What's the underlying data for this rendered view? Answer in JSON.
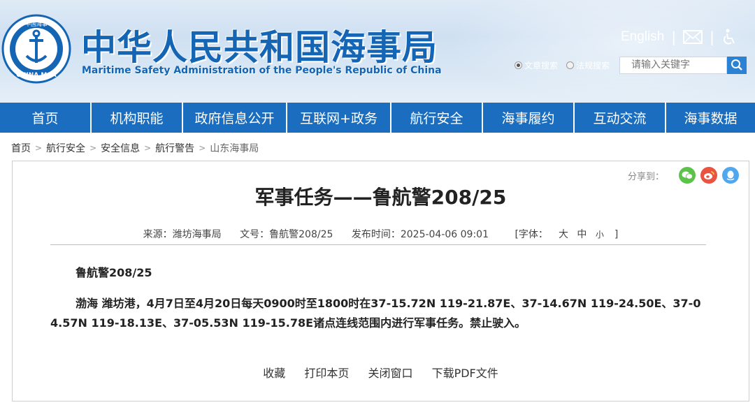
{
  "header": {
    "title": "中华人民共和国海事局",
    "subtitle": "Maritime Safety Administration of the People's Republic of China",
    "logo_text": "CHINA MSA",
    "logo_top_text": "中国海事",
    "english_label": "English",
    "icons": [
      "mail-icon",
      "accessibility-icon"
    ],
    "search": {
      "options": [
        {
          "label": "文章搜索",
          "selected": true
        },
        {
          "label": "法规搜索",
          "selected": false
        }
      ],
      "placeholder": "请输入关键字"
    },
    "brand_color": "#1565b5"
  },
  "nav": {
    "items": [
      "首页",
      "机构职能",
      "政府信息公开",
      "互联网+政务",
      "航行安全",
      "海事履约",
      "互动交流",
      "海事数据"
    ],
    "color": "#1a6dbf"
  },
  "breadcrumb": [
    "首页",
    "航行安全",
    "安全信息",
    "航行警告",
    "山东海事局"
  ],
  "share": {
    "label": "分享到：",
    "icons": [
      "wechat-icon",
      "weibo-icon",
      "qq-icon"
    ],
    "colors": [
      "#5cc24a",
      "#e9533f",
      "#4ea7ef"
    ]
  },
  "article": {
    "title": "军事任务——鲁航警208/25",
    "meta": {
      "source": "来源：潍坊海事局",
      "doc_no": "文号：鲁航警208/25",
      "published": "发布时间：2025-04-06 09:01",
      "font_label": "[字体：",
      "font_large": "大",
      "font_medium": "中",
      "font_small": "小",
      "font_close": "]"
    },
    "paragraphs": [
      "鲁航警208/25",
      "渤海 潍坊港，4月7日至4月20日每天0900时至1800时在37-15.72N 119-21.87E、37-14.67N 119-24.50E、37-04.57N 119-18.13E、37-05.53N 119-15.78E诸点连线范围内进行军事任务。禁止驶入。"
    ],
    "actions": [
      "收藏",
      "打印本页",
      "关闭窗口",
      "下载PDF文件"
    ]
  }
}
